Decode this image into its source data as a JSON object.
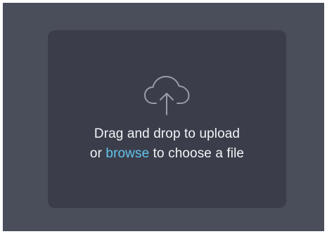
{
  "dropzone": {
    "icon": "cloud-upload-icon",
    "line1": "Drag and drop to upload",
    "line2_prefix": "or",
    "browse_label": "browse",
    "line2_suffix": "to choose a file"
  },
  "colors": {
    "background": "#4a4d5a",
    "dropzone_background": "#3b3e4a",
    "text": "#f2f3f6",
    "link": "#63c3ee",
    "icon": "#9a9ca6"
  }
}
